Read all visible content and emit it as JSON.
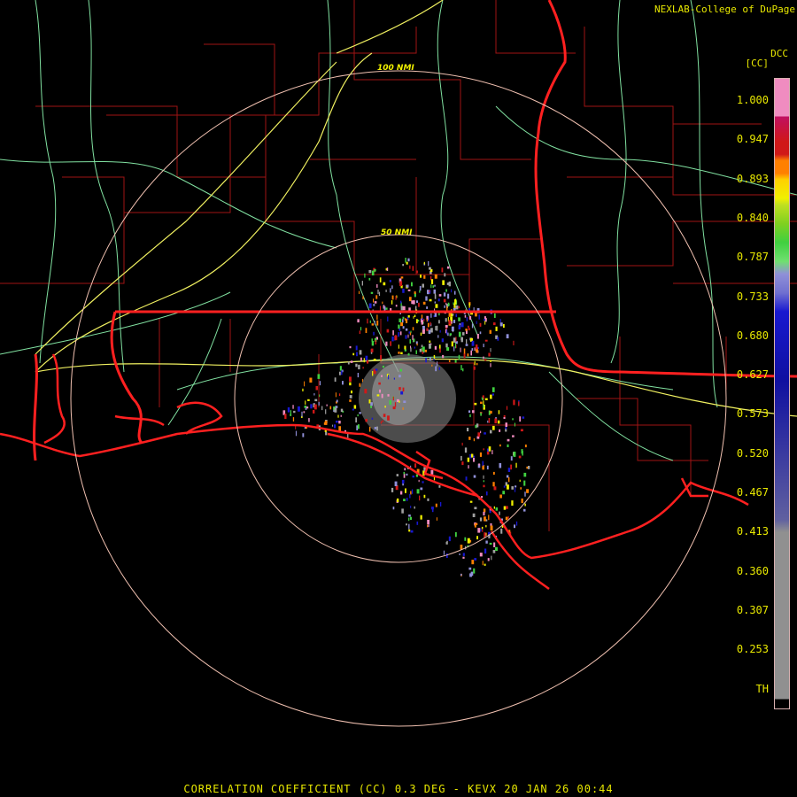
{
  "header": {
    "credit": "NEXLAB-College of DuPage",
    "credit_icon": "dcc-logo-fragment",
    "site_code": "DCC",
    "unit_label": "[CC]"
  },
  "range_rings": [
    {
      "label": "100 NMI"
    },
    {
      "label": "50 NMI"
    }
  ],
  "legend": {
    "ticks": [
      "1.000",
      "0.947",
      "0.893",
      "0.840",
      "0.787",
      "0.733",
      "0.680",
      "0.627",
      "0.573",
      "0.520",
      "0.467",
      "0.413",
      "0.360",
      "0.307",
      "0.253",
      "TH"
    ],
    "colors": {
      "pink": "#f08cc0",
      "red": "#d01818",
      "orange": "#ff8000",
      "yellow": "#f0f000",
      "green": "#40d040",
      "lavender": "#9090d8",
      "blue": "#1818d0",
      "gray": "#909090"
    }
  },
  "footer": {
    "title": "CORRELATION COEFFICIENT (CC) 0.3 DEG - KEVX 20 JAN 26 00:44"
  },
  "colors": {
    "state_border": "#ff2020",
    "county_border": "#b01818",
    "highway": "#f0f060",
    "road": "#80e0a0",
    "ring": "#f0c0b0",
    "coast": "#ff2020"
  }
}
